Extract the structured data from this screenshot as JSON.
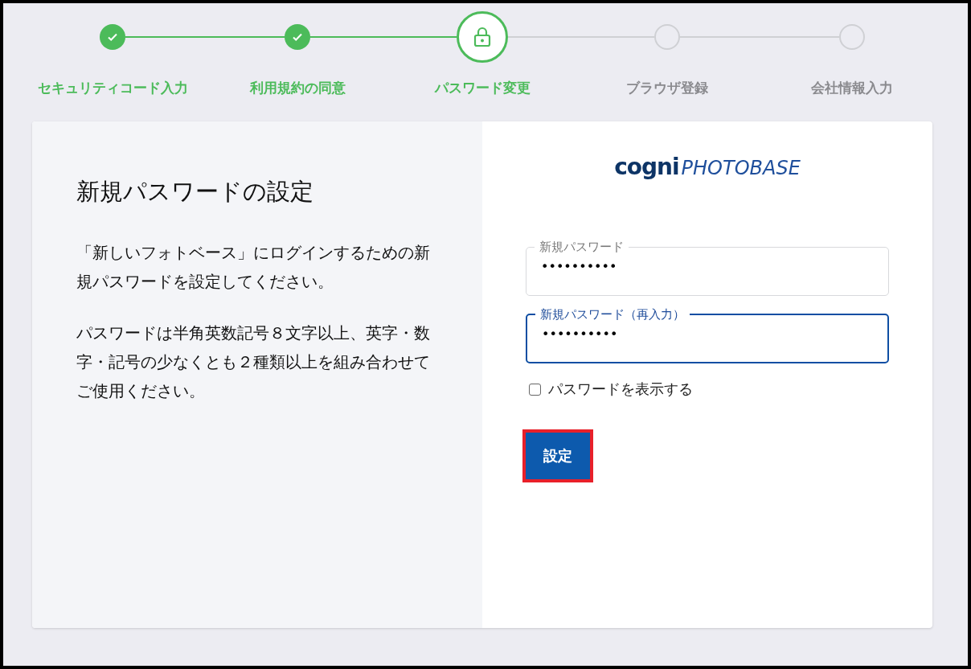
{
  "steps": [
    {
      "label": "セキュリティコード入力",
      "completed": true,
      "selected": false
    },
    {
      "label": "利用規約の同意",
      "completed": true,
      "selected": false
    },
    {
      "label": "パスワード変更",
      "completed": false,
      "selected": true
    },
    {
      "label": "ブラウザ登録",
      "completed": false,
      "selected": false
    },
    {
      "label": "会社情報入力",
      "completed": false,
      "selected": false
    }
  ],
  "info": {
    "title": "新規パスワードの設定",
    "paragraphs": [
      "「新しいフォトベース」にログインするための新規パスワードを設定してください。",
      "パスワードは半角英数記号８文字以上、英字・数字・記号の少なくとも２種類以上を組み合わせてご使用ください。"
    ]
  },
  "logo": {
    "primary": "cogni",
    "secondary": "PHOTOBASE"
  },
  "fields": [
    {
      "label": "新規パスワード",
      "value": "••••••••••",
      "focused": false
    },
    {
      "label": "新規パスワード（再入力）",
      "value": "••••••••••",
      "focused": true
    }
  ],
  "show_password": {
    "label": "パスワードを表示する",
    "checked": false
  },
  "submit": {
    "label": "設定",
    "highlighted": true
  }
}
